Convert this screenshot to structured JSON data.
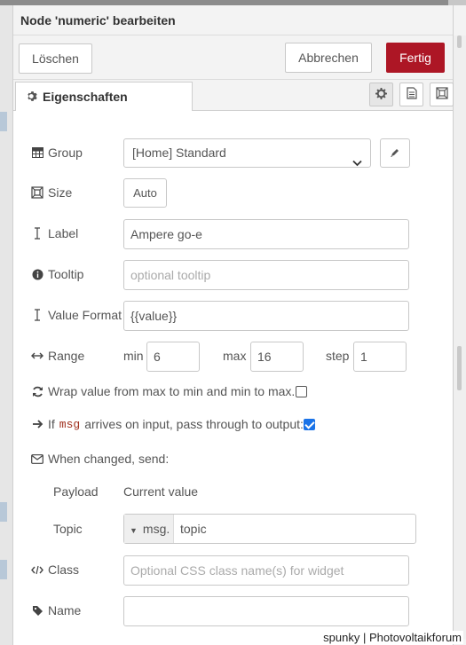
{
  "dialog": {
    "title": "Node 'numeric' bearbeiten",
    "delete_label": "Löschen",
    "cancel_label": "Abbrechen",
    "done_label": "Fertig",
    "accent_color": "#ad1625"
  },
  "tabs": {
    "properties_label": "Eigenschaften",
    "icons": [
      "gear-icon",
      "description-icon",
      "appearance-icon"
    ]
  },
  "form": {
    "group": {
      "label": "Group",
      "value": "[Home] Standard"
    },
    "size": {
      "label": "Size",
      "value": "Auto"
    },
    "label": {
      "label": "Label",
      "value": "Ampere go-e"
    },
    "tooltip": {
      "label": "Tooltip",
      "placeholder": "optional tooltip"
    },
    "value_format": {
      "label": "Value Format",
      "value": "{{value}}"
    },
    "range": {
      "label": "Range",
      "min_label": "min",
      "min": "6",
      "max_label": "max",
      "max": "16",
      "step_label": "step",
      "step": "1"
    },
    "wrap": {
      "label": "Wrap value from max to min and min to max.",
      "checked": false
    },
    "passthrough": {
      "label_before": "If",
      "code": "msg",
      "label_after": "arrives on input, pass through to output:",
      "checked": true
    },
    "send": {
      "label": "When changed, send:"
    },
    "payload": {
      "label": "Payload",
      "value": "Current value"
    },
    "topic": {
      "label": "Topic",
      "prefix": "msg.",
      "value": "topic"
    },
    "class": {
      "label": "Class",
      "placeholder": "Optional CSS class name(s) for widget"
    },
    "name": {
      "label": "Name",
      "value": ""
    }
  },
  "watermark": "spunky | Photovoltaikforum"
}
